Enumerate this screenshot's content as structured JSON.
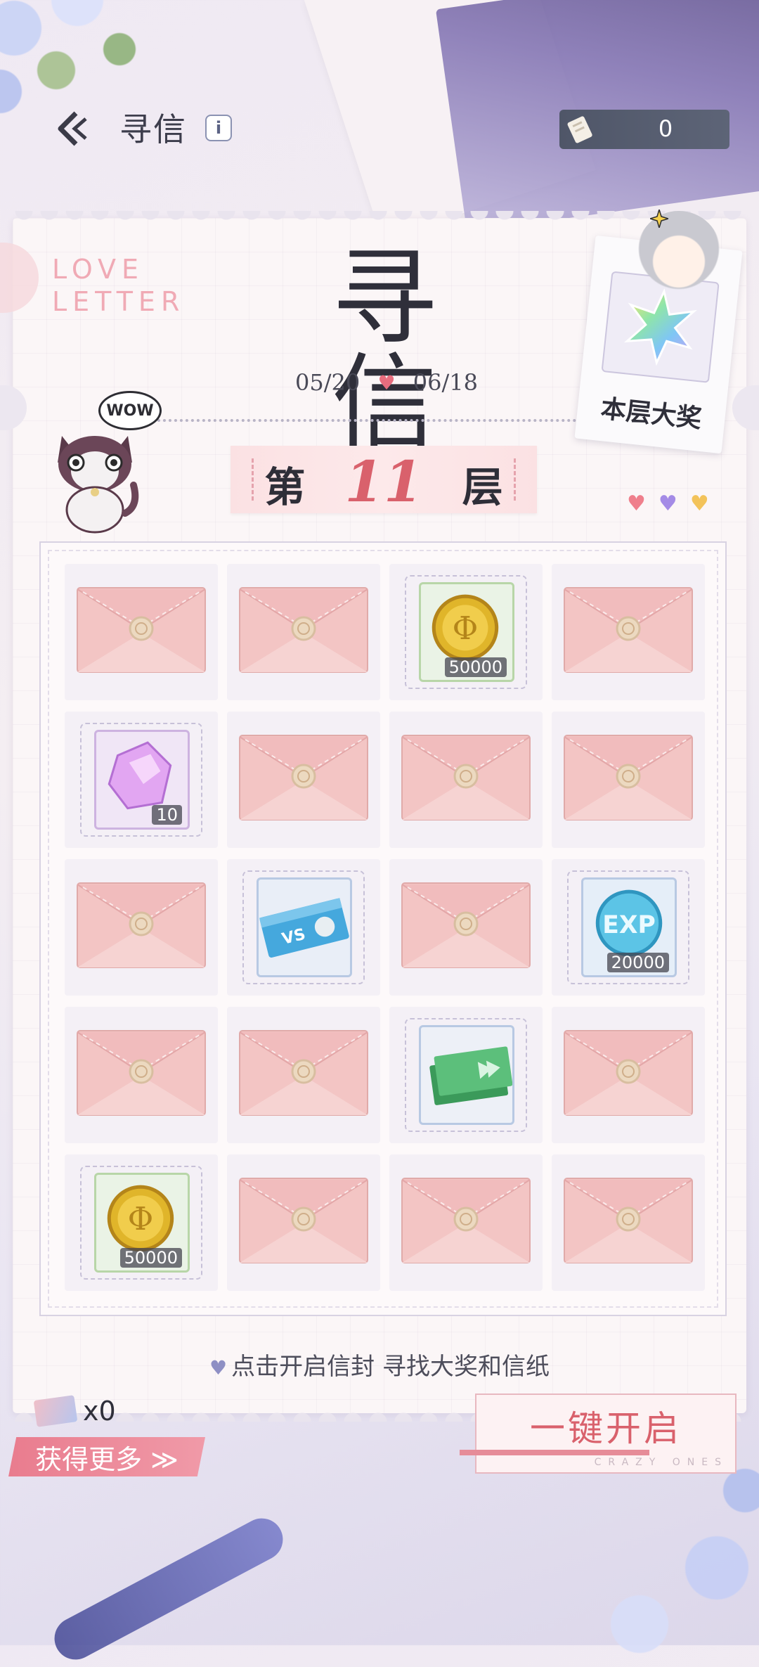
{
  "header": {
    "title": "寻信",
    "counter_value": "0"
  },
  "card": {
    "love_letter_line1": "LOVE",
    "love_letter_line2": "LETTER",
    "big_title": "寻信",
    "date_start": "05/20",
    "date_end": "06/18",
    "wow": "WOW",
    "prize_label": "本层大奖",
    "floor_prefix": "第",
    "floor_number": "11",
    "floor_suffix": "层"
  },
  "grid": {
    "cells": [
      {
        "type": "envelope"
      },
      {
        "type": "envelope"
      },
      {
        "type": "coin",
        "qty": "50000"
      },
      {
        "type": "envelope"
      },
      {
        "type": "crystal",
        "qty": "10"
      },
      {
        "type": "envelope"
      },
      {
        "type": "envelope"
      },
      {
        "type": "envelope"
      },
      {
        "type": "envelope"
      },
      {
        "type": "ticket-blue"
      },
      {
        "type": "envelope"
      },
      {
        "type": "exp",
        "qty": "20000"
      },
      {
        "type": "envelope"
      },
      {
        "type": "envelope"
      },
      {
        "type": "ticket-green"
      },
      {
        "type": "envelope"
      },
      {
        "type": "coin",
        "qty": "50000"
      },
      {
        "type": "envelope"
      },
      {
        "type": "envelope"
      },
      {
        "type": "envelope"
      }
    ]
  },
  "footer": {
    "hint": "点击开启信封  寻找大奖和信纸",
    "ticket_count": "x0",
    "get_more": "获得更多 ≫",
    "open_all": "一键开启",
    "open_all_sub": "CRAZY ONES"
  },
  "colors": {
    "accent_pink": "#d9616c",
    "button_pink": "#e97c8e",
    "envelope": "#f3c7c6",
    "seal": "#e8d2b8"
  },
  "icons": {
    "back": "chevron-left-icon",
    "info": "info-icon",
    "counter": "scroll-letter-icon",
    "prize": "rainbow-star-icon",
    "hearts": [
      "heart-red-icon",
      "heart-purple-icon",
      "heart-yellow-icon"
    ]
  }
}
